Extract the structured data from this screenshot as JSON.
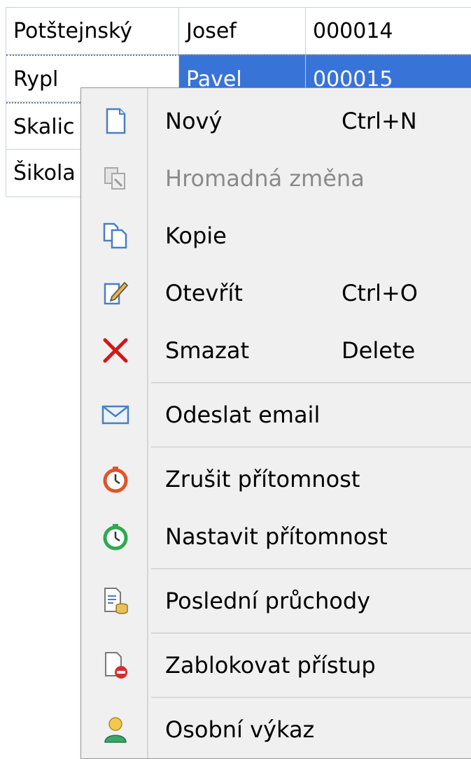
{
  "table": {
    "rows": [
      {
        "surname": "Potštejnský",
        "name": "Josef",
        "id": "000014"
      },
      {
        "surname": "Rypl",
        "name": "Pavel",
        "id": "000015"
      },
      {
        "surname": "Skalic",
        "name": "",
        "id": ""
      },
      {
        "surname": "Šikola",
        "name": "",
        "id": ""
      }
    ]
  },
  "menu": {
    "items": [
      {
        "label": "Nový",
        "shortcut": "Ctrl+N",
        "icon": "new-document-icon"
      },
      {
        "label": "Hromadná změna",
        "shortcut": "",
        "icon": "bulk-change-icon",
        "disabled": true
      },
      {
        "label": "Kopie",
        "shortcut": "",
        "icon": "copy-icon"
      },
      {
        "label": "Otevřít",
        "shortcut": "Ctrl+O",
        "icon": "edit-icon"
      },
      {
        "label": "Smazat",
        "shortcut": "Delete",
        "icon": "delete-icon"
      },
      {
        "label": "Odeslat email",
        "shortcut": "",
        "icon": "email-icon"
      },
      {
        "label": "Zrušit přítomnost",
        "shortcut": "",
        "icon": "cancel-presence-icon"
      },
      {
        "label": "Nastavit přítomnost",
        "shortcut": "",
        "icon": "set-presence-icon"
      },
      {
        "label": "Poslední průchody",
        "shortcut": "",
        "icon": "recent-passages-icon"
      },
      {
        "label": "Zablokovat přístup",
        "shortcut": "",
        "icon": "block-access-icon"
      },
      {
        "label": "Osobní výkaz",
        "shortcut": "",
        "icon": "personal-report-icon"
      }
    ]
  },
  "colors": {
    "selection": "#3874d8",
    "menu_background": "#f0f0f0",
    "disabled_text": "#8a8a8a",
    "delete_red": "#d01818"
  }
}
